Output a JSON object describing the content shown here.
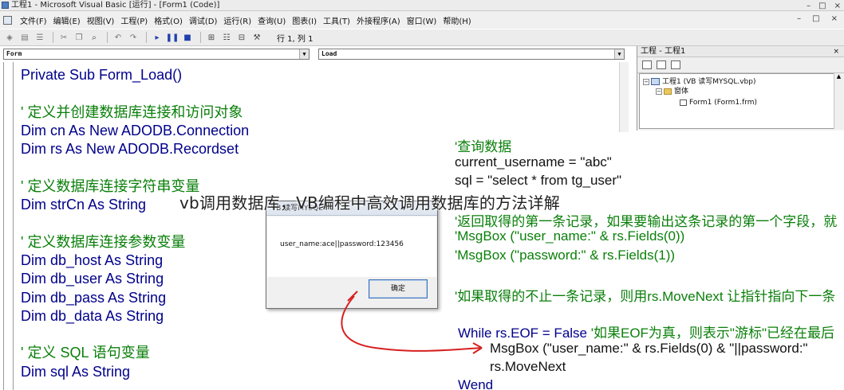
{
  "window": {
    "title": "工程1 - Microsoft Visual Basic [运行] - [Form1 (Code)]",
    "controls": [
      "–",
      "□",
      "×"
    ]
  },
  "menubar": {
    "items": [
      "文件(F)",
      "编辑(E)",
      "视图(V)",
      "工程(P)",
      "格式(O)",
      "调试(D)",
      "运行(R)",
      "查询(U)",
      "图表(I)",
      "工具(T)",
      "外接程序(A)",
      "窗口(W)",
      "帮助(H)"
    ],
    "mdi_controls": [
      "–",
      "□",
      "×"
    ]
  },
  "toolbar": {
    "icons": [
      "add-project-icon",
      "add-form-icon",
      "menu-editor-icon",
      "cut-icon",
      "copy-icon",
      "find-icon",
      "undo-icon",
      "redo-icon",
      "start-icon",
      "break-icon",
      "end-icon",
      "project-explorer-icon",
      "properties-icon",
      "object-browser-icon",
      "toolbox-icon"
    ],
    "cursor_position": "行 1, 列 1"
  },
  "code_window": {
    "object_combo": "Form",
    "procedure_combo": "Load",
    "lines": [
      "Private Sub Form_Load()",
      "",
      "' 定义并创建数据库连接和访问对象",
      "Dim cn As New ADODB.Connection",
      "Dim rs As New ADODB.Recordset",
      "",
      "' 定义数据库连接字符串变量",
      "Dim strCn As String",
      "",
      "' 定义数据库连接参数变量",
      "Dim db_host As String",
      "Dim db_user As String",
      "Dim db_pass As String",
      "Dim db_data As String",
      "",
      "' 定义 SQL 语句变量",
      "Dim sql As String"
    ]
  },
  "project_explorer": {
    "title": "工程 - 工程1",
    "close": "×",
    "root": "工程1 (VB 读写MYSQL.vbp)",
    "folder": "窗体",
    "form": "Form1 (Form1.frm)"
  },
  "annotation": {
    "lines": [
      "'查询数据",
      "current_username = \"abc\"",
      "sql = \"select * from tg_user\"",
      "",
      "'返回取得的第一条记录，如果要输出这条记录的第一个字段，就",
      "'MsgBox (\"user_name:\" & rs.Fields(0))",
      "'MsgBox (\"password:\" & rs.Fields(1))",
      "",
      "'如果取得的不止一条记录，则用rs.MoveNext 让指针指向下一条",
      "",
      "While rs.EOF = False '如果EOF为真，则表示\"游标\"已经在最后",
      "MsgBox (\"user_name:\" & rs.Fields(0) & \"||password:\"",
      "rs.MoveNext",
      "Wend"
    ]
  },
  "msgbox": {
    "title": "VB 读写MYSQL",
    "message": "user_name:ace||password:123456",
    "ok_label": "确定"
  },
  "article_title": "vb调用数据库，VB编程中高效调用数据库的方法详解",
  "colors": {
    "keyword": "#00008b",
    "comment": "#0a7f0a",
    "arrow": "#d62020"
  }
}
